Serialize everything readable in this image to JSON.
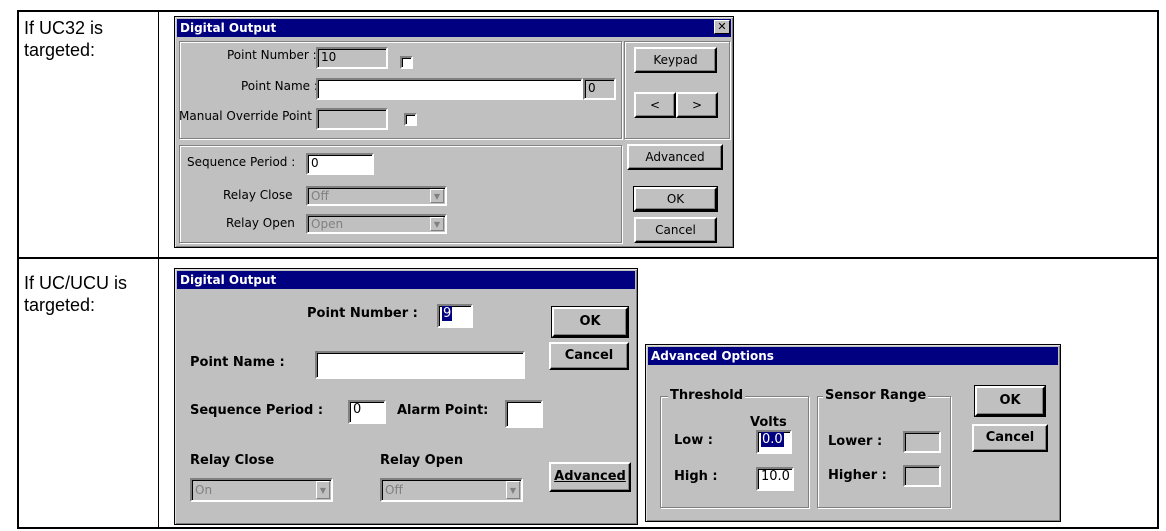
{
  "rows": [
    {
      "label": "If UC32 is\ntargeted:"
    },
    {
      "label": "If UC/UCU is\ntargeted:"
    }
  ],
  "uc32": {
    "title": "Digital Output",
    "close": "✕",
    "point_number_label": "Point Number :",
    "point_number_value": "10",
    "point_name_label": "Point Name :",
    "point_name_value": "",
    "point_name_count": "0",
    "manual_override_label": "Manual Override Point",
    "manual_override_value": "",
    "sequence_period_label": "Sequence Period :",
    "sequence_period_value": "0",
    "relay_close_label": "Relay Close",
    "relay_close_value": "Off",
    "relay_open_label": "Relay Open",
    "relay_open_value": "Open",
    "keypad": "Keypad",
    "prev": "<",
    "next": ">",
    "advanced": "Advanced",
    "ok": "OK",
    "cancel": "Cancel"
  },
  "uc": {
    "title": "Digital Output",
    "point_number_label": "Point Number :",
    "point_number_value": "9",
    "point_name_label": "Point Name :",
    "point_name_value": "",
    "sequence_period_label": "Sequence Period :",
    "sequence_period_value": "0",
    "alarm_point_label": "Alarm Point:",
    "alarm_point_value": "",
    "relay_close_label": "Relay Close",
    "relay_close_value": "On",
    "relay_open_label": "Relay Open",
    "relay_open_value": "Off",
    "ok": "OK",
    "cancel": "Cancel",
    "advanced": "Advanced"
  },
  "advanced": {
    "title": "Advanced Options",
    "threshold_label": "Threshold",
    "volts_label": "Volts",
    "low_label": "Low :",
    "low_value": "0.0",
    "high_label": "High :",
    "high_value": "10.0",
    "sensor_range_label": "Sensor Range",
    "lower_label": "Lower :",
    "lower_value": "",
    "higher_label": "Higher :",
    "higher_value": "",
    "ok": "OK",
    "cancel": "Cancel"
  }
}
